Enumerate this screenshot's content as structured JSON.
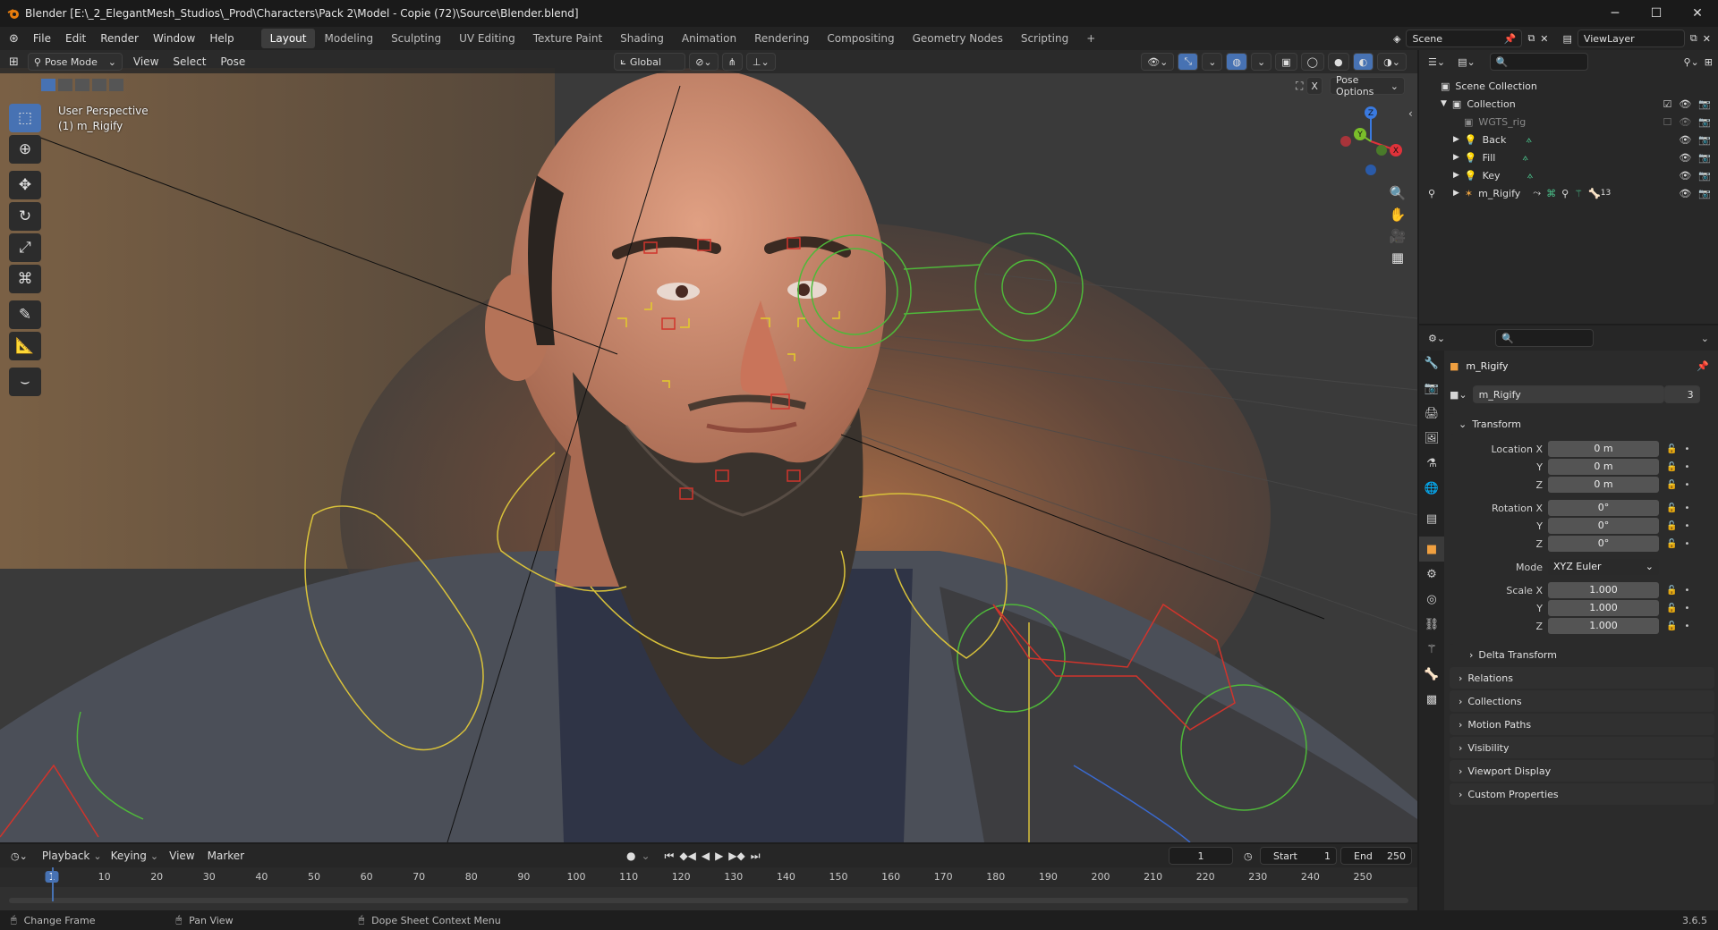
{
  "titlebar": {
    "title": "Blender [E:\\_2_ElegantMesh_Studios\\_Prod\\Characters\\Pack 2\\Model - Copie (72)\\Source\\Blender.blend]"
  },
  "menu": [
    "File",
    "Edit",
    "Render",
    "Window",
    "Help"
  ],
  "workspaces": [
    "Layout",
    "Modeling",
    "Sculpting",
    "UV Editing",
    "Texture Paint",
    "Shading",
    "Animation",
    "Rendering",
    "Compositing",
    "Geometry Nodes",
    "Scripting"
  ],
  "scene": {
    "name": "Scene",
    "view_layer": "ViewLayer"
  },
  "viewport": {
    "mode": "Pose Mode",
    "menus": [
      "View",
      "Select",
      "Pose"
    ],
    "orientation": "Global",
    "pose_options": "Pose Options",
    "overlay_line1": "User Perspective",
    "overlay_line2": "(1) m_Rigify",
    "gizmo_axes": [
      "X",
      "Y",
      "Z"
    ]
  },
  "outliner": {
    "root": "Scene Collection",
    "collection": "Collection",
    "items": [
      {
        "label": "WGTS_rig"
      },
      {
        "label": "Back"
      },
      {
        "label": "Fill"
      },
      {
        "label": "Key"
      },
      {
        "label": "m_Rigify",
        "badge": "13"
      }
    ]
  },
  "properties": {
    "object_name": "m_Rigify",
    "datablock_name": "m_Rigify",
    "datablock_users": "3",
    "transform_title": "Transform",
    "location": {
      "label_x": "Location X",
      "label_y": "Y",
      "label_z": "Z",
      "x": "0 m",
      "y": "0 m",
      "z": "0 m"
    },
    "rotation": {
      "label_x": "Rotation X",
      "label_y": "Y",
      "label_z": "Z",
      "x": "0°",
      "y": "0°",
      "z": "0°"
    },
    "mode_label": "Mode",
    "mode_value": "XYZ Euler",
    "scale": {
      "label_x": "Scale X",
      "label_y": "Y",
      "label_z": "Z",
      "x": "1.000",
      "y": "1.000",
      "z": "1.000"
    },
    "delta_transform": "Delta Transform",
    "panels": [
      "Relations",
      "Collections",
      "Motion Paths",
      "Visibility",
      "Viewport Display",
      "Custom Properties"
    ]
  },
  "timeline": {
    "menus": [
      "Playback",
      "Keying",
      "View",
      "Marker"
    ],
    "current_frame": "1",
    "start_label": "Start",
    "start": "1",
    "end_label": "End",
    "end": "250",
    "ticks": [
      "1",
      "10",
      "20",
      "30",
      "40",
      "50",
      "60",
      "70",
      "80",
      "90",
      "100",
      "110",
      "120",
      "130",
      "140",
      "150",
      "160",
      "170",
      "180",
      "190",
      "200",
      "210",
      "220",
      "230",
      "240",
      "250"
    ]
  },
  "statusbar": {
    "hint1": "Change Frame",
    "hint2": "Pan View",
    "hint3": "Dope Sheet Context Menu",
    "version": "3.6.5"
  }
}
